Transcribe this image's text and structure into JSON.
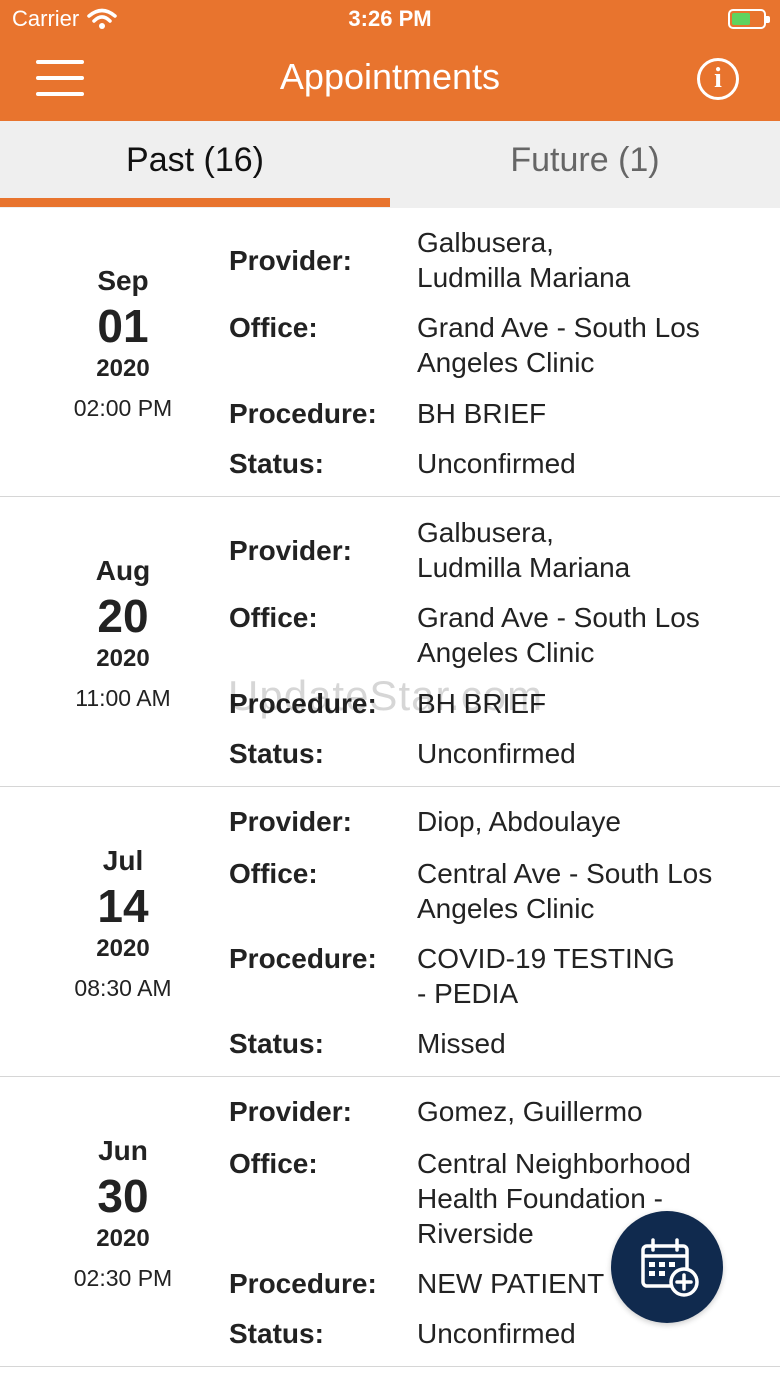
{
  "status_bar": {
    "carrier": "Carrier",
    "time": "3:26 PM"
  },
  "header": {
    "title": "Appointments",
    "background_color": "#E8742E"
  },
  "tabs": [
    {
      "label": "Past (16)",
      "active": true
    },
    {
      "label": "Future (1)",
      "active": false
    }
  ],
  "field_labels": {
    "provider": "Provider:",
    "office": "Office:",
    "procedure": "Procedure:",
    "status": "Status:"
  },
  "appointments": [
    {
      "month": "Sep",
      "day": "01",
      "year": "2020",
      "time": "02:00 PM",
      "provider_line1": "Galbusera,",
      "provider_line2": "Ludmilla Mariana",
      "office_line1": "Grand Ave - South Los",
      "office_line2": "Angeles Clinic",
      "procedure_line1": "BH BRIEF",
      "status": "Unconfirmed"
    },
    {
      "month": "Aug",
      "day": "20",
      "year": "2020",
      "time": "11:00 AM",
      "provider_line1": "Galbusera,",
      "provider_line2": "Ludmilla Mariana",
      "office_line1": "Grand Ave - South Los",
      "office_line2": "Angeles Clinic",
      "procedure_line1": "BH BRIEF",
      "status": "Unconfirmed"
    },
    {
      "month": "Jul",
      "day": "14",
      "year": "2020",
      "time": "08:30 AM",
      "provider_line1": "Diop, Abdoulaye",
      "office_line1": "Central Ave - South Los",
      "office_line2": "Angeles Clinic",
      "procedure_line1": "COVID-19 TESTING",
      "procedure_line2": "- PEDIA",
      "status": "Missed"
    },
    {
      "month": "Jun",
      "day": "30",
      "year": "2020",
      "time": "02:30 PM",
      "provider_line1": "Gomez, Guillermo",
      "office_line1": "Central Neighborhood",
      "office_line2": "Health Foundation -",
      "office_line3": "Riverside",
      "procedure_line1": "NEW PATIENT",
      "status": "Unconfirmed"
    }
  ],
  "watermark": "UpdateStar.com",
  "fab": {
    "icon": "calendar-add-icon",
    "color": "#102A4E"
  }
}
